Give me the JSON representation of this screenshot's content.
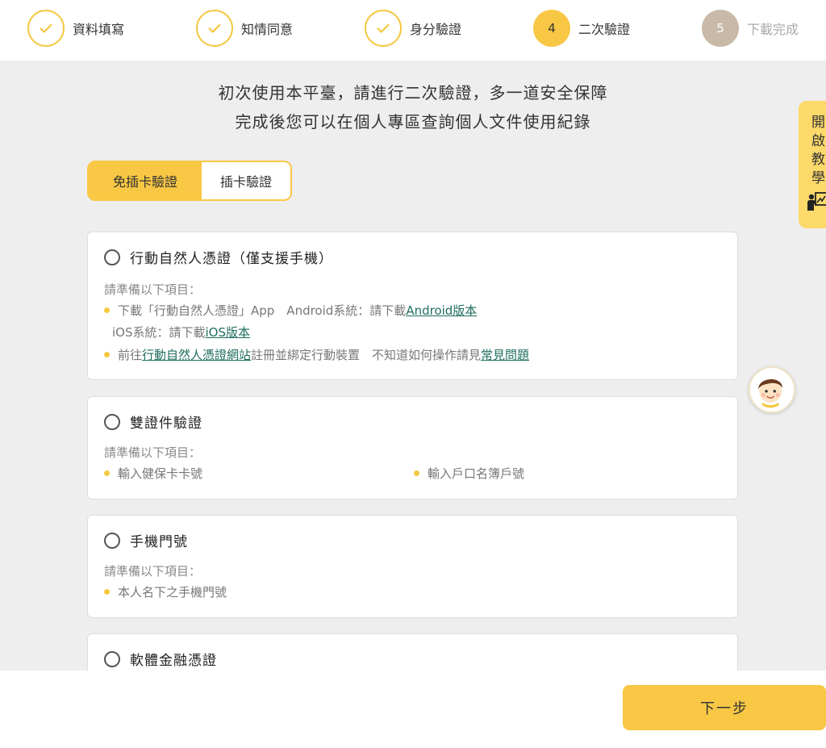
{
  "stepper": {
    "steps": [
      {
        "label": "資料填寫",
        "state": "done"
      },
      {
        "label": "知情同意",
        "state": "done"
      },
      {
        "label": "身分驗證",
        "state": "done"
      },
      {
        "number": "4",
        "label": "二次驗證",
        "state": "active"
      },
      {
        "number": "5",
        "label": "下載完成",
        "state": "pending"
      }
    ]
  },
  "intro": {
    "line1": "初次使用本平臺，請進行二次驗證，多一道安全保障",
    "line2": "完成後您可以在個人專區查詢個人文件使用紀錄"
  },
  "toggle": {
    "active_label": "免插卡驗證",
    "inactive_label": "插卡驗證"
  },
  "options": [
    {
      "title": "行動自然人憑證（僅支援手機）",
      "prep": "請準備以下項目：",
      "line1_text": "下載「行動自然人憑證」App　Android系統：請下載 ",
      "line1_link": "Android版本",
      "line2_text": "iOS系統：請下載",
      "line2_link": "iOS版本",
      "line3_text_a": "前往",
      "line3_link_a": "行動自然人憑證網站",
      "line3_text_b": "註冊並綁定行動裝置　不知道如何操作請見",
      "line3_link_b": "常見問題"
    },
    {
      "title": "雙證件驗證",
      "prep": "請準備以下項目：",
      "item1": "輸入健保卡卡號",
      "item2": "輸入戶口名簿戶號"
    },
    {
      "title": "手機門號",
      "prep": "請準備以下項目：",
      "item1": "本人名下之手機門號"
    },
    {
      "title": "軟體金融憑證"
    }
  ],
  "side_tab": {
    "label": "開啟教學",
    "icon": "teaching-icon"
  },
  "avatar": {
    "icon": "assistant-avatar-icon"
  },
  "footer": {
    "next_label": "下一步"
  },
  "colors": {
    "accent": "#f8c744",
    "link": "#1f6e5f",
    "pending": "#c8b9a8",
    "background": "#eeeeee"
  }
}
